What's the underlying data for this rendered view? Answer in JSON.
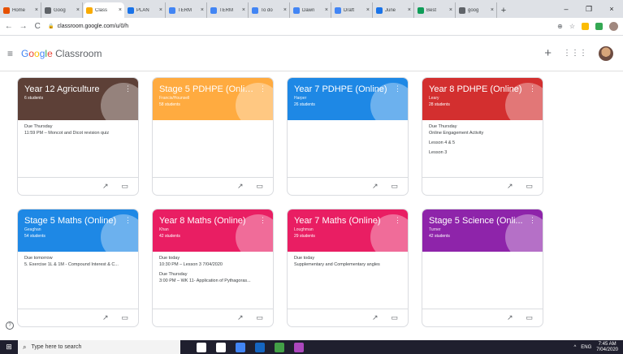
{
  "browser": {
    "tabs": [
      {
        "label": "Home",
        "color": "#e65100"
      },
      {
        "label": "Goog",
        "color": "#5f6368"
      },
      {
        "label": "Class",
        "color": "#f9ab00",
        "active": true
      },
      {
        "label": "PLAN",
        "color": "#1a73e8"
      },
      {
        "label": "TERM",
        "color": "#4285f4"
      },
      {
        "label": "TERM",
        "color": "#4285f4"
      },
      {
        "label": "To do",
        "color": "#4285f4"
      },
      {
        "label": "Dawn",
        "color": "#4285f4"
      },
      {
        "label": "Draft",
        "color": "#4285f4"
      },
      {
        "label": "June",
        "color": "#1a73e8"
      },
      {
        "label": "Best",
        "color": "#0f9d58"
      },
      {
        "label": "goog",
        "color": "#5f6368"
      }
    ],
    "tab_close": "×",
    "new_tab": "+",
    "window_controls": {
      "minimize": "–",
      "maximize": "❐",
      "close": "×"
    },
    "nav": {
      "back": "←",
      "forward": "→",
      "reload": "C"
    },
    "url": "classroom.google.com/u/0/h",
    "lock": "🔒",
    "toolbar_icons": {
      "zoom": "⊕",
      "star": "☆"
    }
  },
  "app": {
    "menu": "≡",
    "brand": {
      "g": "G",
      "o1": "o",
      "o2": "o",
      "g2": "g",
      "l": "l",
      "e": "e",
      "rest": " Classroom"
    },
    "plus": "+",
    "apps": "⋮⋮⋮"
  },
  "classes": [
    {
      "title": "Year 12 Agriculture",
      "teacher": "",
      "students": "6 students",
      "color": "#5d4037",
      "work": [
        {
          "due": "Due Thursday",
          "item": "11:59 PM – Moncot and Dicot revision quiz"
        }
      ]
    },
    {
      "title": "Stage 5 PDHPE (Onlin...",
      "teacher": "Francis/Hounsell",
      "students": "58 students",
      "color": "#ffab40",
      "work": []
    },
    {
      "title": "Year 7 PDHPE (Online)",
      "teacher": "Harper",
      "students": "26 students",
      "color": "#1e88e5",
      "work": []
    },
    {
      "title": "Year 8 PDHPE (Online)",
      "teacher": "Leary",
      "students": "28 students",
      "color": "#d32f2f",
      "work": [
        {
          "due": "Due Thursday",
          "item": "Online Engagement Activity"
        },
        {
          "due": "",
          "item": "Lesson 4 & 5"
        },
        {
          "due": "",
          "item": "Lesson 3"
        }
      ]
    },
    {
      "title": "Stage 5 Maths (Online)",
      "teacher": "Geaghan",
      "students": "54 students",
      "color": "#1e88e5",
      "work": [
        {
          "due": "Due tomorrow",
          "item": "5. Exercise 1L & 1M - Compound Interest & C..."
        }
      ]
    },
    {
      "title": "Year 8 Maths (Online)",
      "teacher": "Khan",
      "students": "42 students",
      "color": "#e91e63",
      "work": [
        {
          "due": "Due today",
          "item": "10:30 PM – Lesson 3 7/04/2020"
        },
        {
          "due": "Due Thursday",
          "item": "3:00 PM – WK 11- Application of Pythagoras..."
        }
      ]
    },
    {
      "title": "Year 7 Maths (Online)",
      "teacher": "Loughman",
      "students": "29 students",
      "color": "#e91e63",
      "work": [
        {
          "due": "Due today",
          "item": "Supplementary and Complementary angles"
        }
      ]
    },
    {
      "title": "Stage 5 Science (Onli...",
      "teacher": "Turner",
      "students": "42 students",
      "color": "#8e24aa",
      "work": []
    }
  ],
  "card_actions": {
    "gradebook": "↗",
    "folder": "▭",
    "kebab": "⋮"
  },
  "help": "?",
  "taskbar": {
    "start": "⊞",
    "search_icon": "⌕",
    "search_placeholder": "Type here to search",
    "icons": [
      "#ffffff",
      "#ffffff",
      "#4285f4",
      "#1565c0",
      "#43a047",
      "#ab47bc"
    ],
    "tray": {
      "lang": "ENG",
      "time": "7:45 AM",
      "date": "7/04/2020",
      "up": "^"
    }
  }
}
